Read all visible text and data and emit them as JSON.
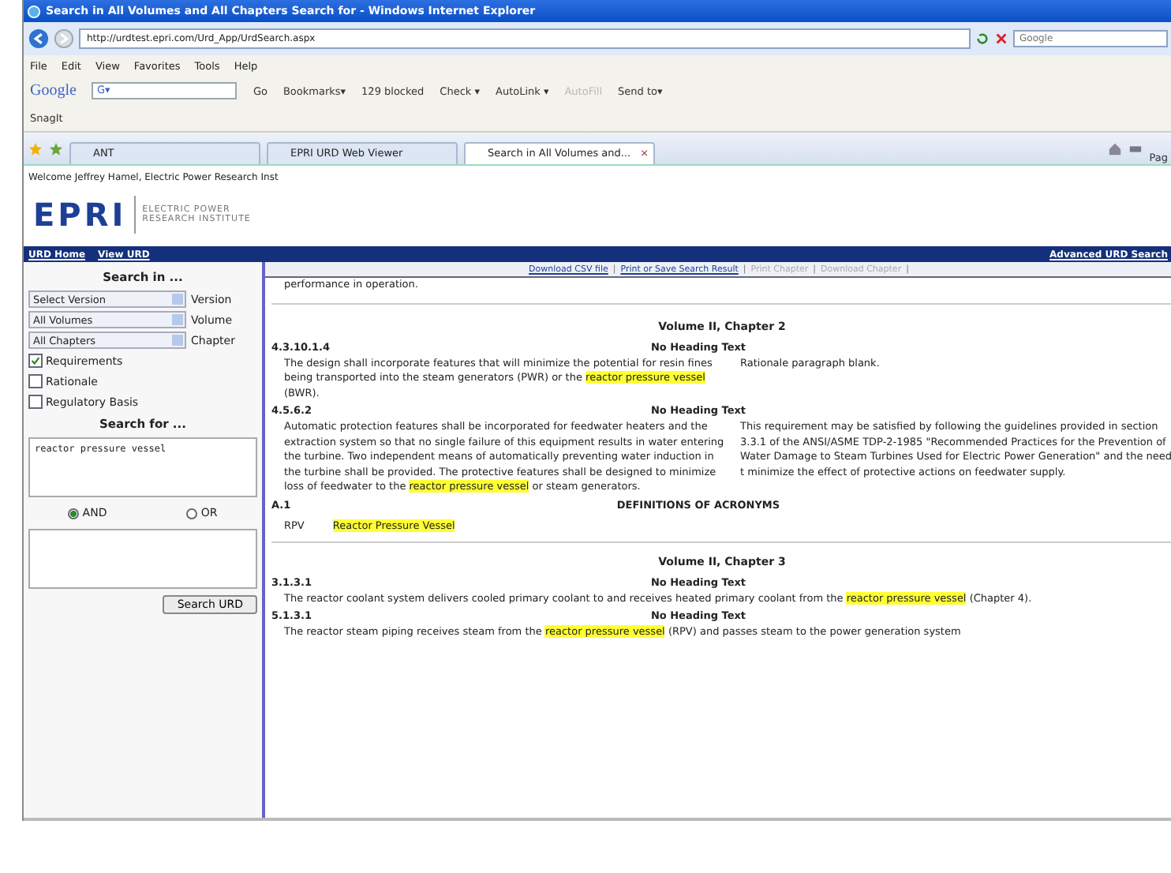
{
  "window": {
    "title": "Search in All Volumes and All Chapters Search for - Windows Internet Explorer"
  },
  "address_bar": {
    "url": "http://urdtest.epri.com/Urd_App/UrdSearch.aspx",
    "search_placeholder": "Google"
  },
  "menu": [
    "File",
    "Edit",
    "View",
    "Favorites",
    "Tools",
    "Help"
  ],
  "google_toolbar": {
    "logo": "Google",
    "field": "G▾",
    "items": [
      {
        "label": "Go",
        "disabled": false
      },
      {
        "label": "Bookmarks▾",
        "disabled": false
      },
      {
        "label": "129 blocked",
        "disabled": false
      },
      {
        "label": "Check ▾",
        "disabled": false
      },
      {
        "label": "AutoLink ▾",
        "disabled": false
      },
      {
        "label": "AutoFill",
        "disabled": true
      },
      {
        "label": "Send to▾",
        "disabled": false
      }
    ]
  },
  "links_toolbar": {
    "items": [
      "SnagIt"
    ]
  },
  "tabs": [
    {
      "label": "ANT",
      "selected": false
    },
    {
      "label": "EPRI URD Web Viewer",
      "selected": false
    },
    {
      "label": "Search in All Volumes and...",
      "selected": true,
      "close": "×"
    }
  ],
  "command_bar": {
    "page": "Pag"
  },
  "page": {
    "welcome": "Welcome Jeffrey Hamel, Electric Power Research Inst",
    "logo": "EPRI",
    "logo_lines": [
      "ELECTRIC POWER",
      "RESEARCH INSTITUTE"
    ],
    "nav": [
      "URD Home",
      "View URD"
    ],
    "nav_right": "Advanced URD Search"
  },
  "search_panel": {
    "title": "Search in ...",
    "selects": [
      {
        "value": "Select Version",
        "label": "Version"
      },
      {
        "value": "All Volumes",
        "label": "Volume"
      },
      {
        "value": "All Chapters",
        "label": "Chapter"
      }
    ],
    "checkboxes": [
      {
        "label": "Requirements",
        "checked": true
      },
      {
        "label": "Rationale",
        "checked": false
      },
      {
        "label": "Regulatory Basis",
        "checked": false
      }
    ],
    "search_for": "Search for ...",
    "query": "reactor pressure vessel",
    "radios": [
      {
        "label": "AND",
        "selected": true
      },
      {
        "label": "OR",
        "selected": false
      }
    ],
    "button": "Search URD"
  },
  "result_toolbar": {
    "separator": "|",
    "links": [
      {
        "label": "Download CSV file",
        "disabled": false
      },
      {
        "label": "Print or Save Search Result",
        "disabled": false
      },
      {
        "label": "Print Chapter",
        "disabled": true
      },
      {
        "label": "Download Chapter",
        "disabled": true
      }
    ]
  },
  "results": [
    {
      "kind": "fragment",
      "text": [
        {
          "text": "performance in operation.",
          "highlight": false
        }
      ]
    },
    {
      "kind": "volume",
      "title": "Volume II, Chapter 2"
    },
    {
      "kind": "item",
      "number": "4.3.10.1.4",
      "heading": "No Heading Text",
      "left": [
        {
          "text": "The design shall incorporate features that will minimize the potential for resin fines being transported into the steam generators (PWR) or the ",
          "highlight": false
        },
        {
          "text": "reactor pressure vessel",
          "highlight": true
        },
        {
          "text": " (BWR).",
          "highlight": false
        }
      ],
      "right": [
        {
          "text": "Rationale paragraph blank.",
          "highlight": false
        }
      ]
    },
    {
      "kind": "item",
      "number": "4.5.6.2",
      "heading": "No Heading Text",
      "left": [
        {
          "text": "Automatic protection features shall be incorporated for feedwater heaters and the extraction system so that no single failure of this equipment results in water entering the turbine. Two independent means of automatically preventing water induction in the turbine shall be provided. The protective features shall be designed to minimize loss of feedwater to the ",
          "highlight": false
        },
        {
          "text": "reactor pressure vessel",
          "highlight": true
        },
        {
          "text": " or steam generators.",
          "highlight": false
        }
      ],
      "right": [
        {
          "text": "This requirement may be satisfied by following the guidelines provided in section 3.3.1 of the ANSI/ASME TDP-2-1985 \"Recommended Practices for the Prevention of Water Damage to Steam Turbines Used for Electric Power Generation\" and the need t minimize the effect of protective actions on feedwater supply.",
          "highlight": false
        }
      ]
    },
    {
      "kind": "acronym",
      "number": "A.1",
      "heading": "DEFINITIONS OF ACRONYMS",
      "acronym": "RPV",
      "expansion": "Reactor Pressure Vessel",
      "highlight": true
    },
    {
      "kind": "volume",
      "title": "Volume II, Chapter 3"
    },
    {
      "kind": "full",
      "number": "3.1.3.1",
      "heading": "No Heading Text",
      "text": [
        {
          "text": "The reactor coolant system delivers cooled primary coolant to and receives heated primary coolant from the ",
          "highlight": false
        },
        {
          "text": "reactor pressure vessel",
          "highlight": true
        },
        {
          "text": " (Chapter 4).",
          "highlight": false
        }
      ]
    },
    {
      "kind": "full",
      "number": "5.1.3.1",
      "heading": "No Heading Text",
      "text": [
        {
          "text": "The reactor steam piping receives steam from the ",
          "highlight": false
        },
        {
          "text": "reactor pressure vessel",
          "highlight": true
        },
        {
          "text": " (RPV) and passes steam to the power generation system",
          "highlight": false
        }
      ]
    }
  ]
}
